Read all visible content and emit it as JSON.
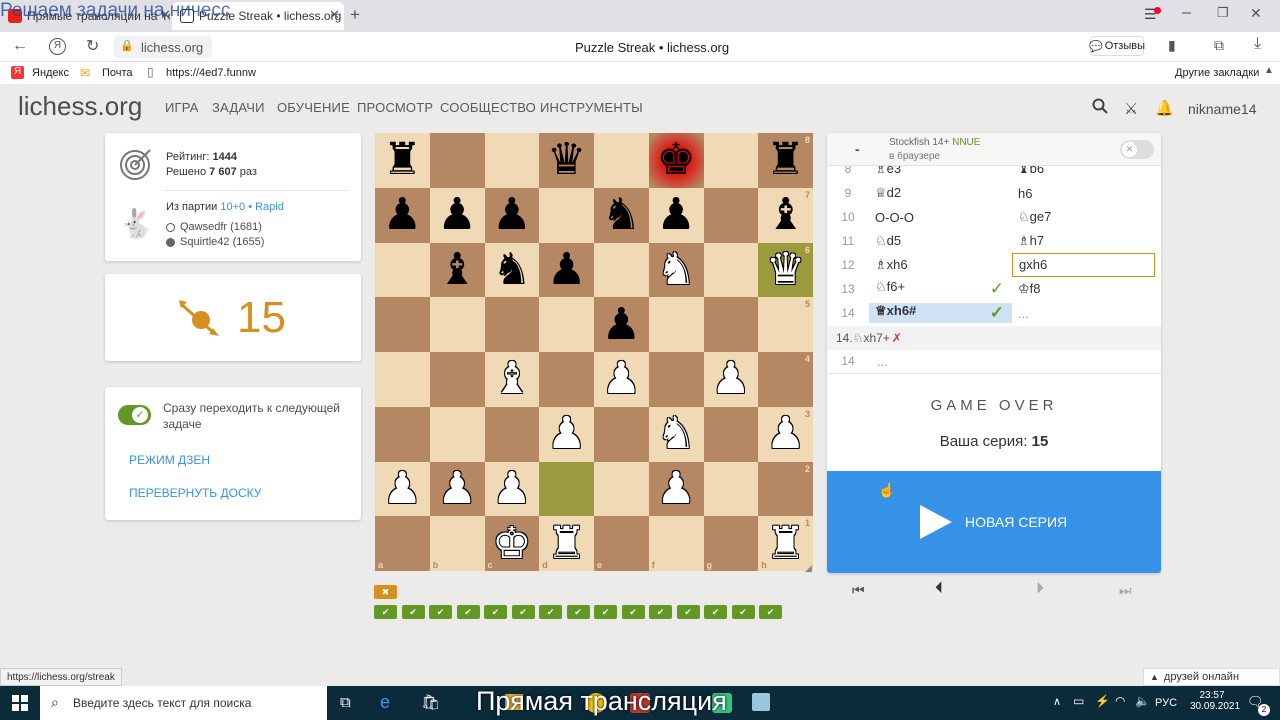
{
  "browser": {
    "tabs": [
      {
        "title": "Прямые трансляции на Youtube"
      },
      {
        "title": "Puzzle Streak • lichess.org"
      }
    ],
    "overlay_title": "Решаем задачи на ничесс",
    "url": "lichess.org",
    "page_title": "Puzzle Streak • lichess.org",
    "feedback": "Отзывы",
    "bookmarks": [
      "Яндекс",
      "Почта",
      "https://4ed7.funnw"
    ],
    "other_bookmarks": "Другие закладки"
  },
  "site": {
    "logo": "lichess",
    "logo_tld": ".org",
    "nav": [
      "ИГРА",
      "ЗАДАЧИ",
      "ОБУЧЕНИЕ",
      "ПРОСМОТР",
      "СООБЩЕСТВО",
      "ИНСТРУМЕНТЫ"
    ],
    "username": "nikname14"
  },
  "info": {
    "rating_label": "Рейтинг:",
    "rating": "1444",
    "solved_label": "Решено",
    "solved": "7 607",
    "solved_suffix": "раз",
    "from_game": "Из партии",
    "game_type": "10+0 • Rapid",
    "player_white": "Qawsedfr (1681)",
    "player_black": "Squirtle42 (1655)"
  },
  "streak": {
    "count": "15"
  },
  "options": {
    "auto_next": "Сразу переходить к следующей задаче",
    "zen": "РЕЖИМ ДЗЕН",
    "flip": "ПЕРЕВЕРНУТЬ ДОСКУ"
  },
  "engine": {
    "toggle": "-",
    "name": "Stockfish 14+",
    "nnue": "NNUE",
    "sub": "в браузере"
  },
  "moves": [
    {
      "n": "8",
      "w": "♗e3",
      "b": "♝b6",
      "wcheck": false
    },
    {
      "n": "9",
      "w": "♕d2",
      "b": "h6",
      "wcheck": false
    },
    {
      "n": "10",
      "w": "O-O-O",
      "b": "♘ge7",
      "wcheck": false
    },
    {
      "n": "11",
      "w": "♘d5",
      "b": "♗h7",
      "wcheck": false
    },
    {
      "n": "12",
      "w": "♗xh6",
      "b": "gxh6",
      "wcheck": false
    },
    {
      "n": "13",
      "w": "♘f6+",
      "b": "♔f8",
      "wcheck": true
    },
    {
      "n": "14",
      "w": "♕xh6#",
      "b": "...",
      "wcheck": true
    }
  ],
  "variation": {
    "text": "14.♘xh7+",
    "mark": "✗"
  },
  "extra_row": {
    "n": "14",
    "b": "..."
  },
  "game_over": {
    "title": "GAME OVER",
    "series_label": "Ваша серия:",
    "series": "15",
    "new_series": "НОВАЯ СЕРИЯ"
  },
  "results": {
    "failed": 1,
    "passed": 15
  },
  "status_url": "https://lichess.org/streak",
  "friends": "друзей онлайн",
  "taskbar": {
    "search": "Введите здесь текст для поиска",
    "overlay": "Прямая трансляция",
    "lang": "РУС",
    "time": "23:57",
    "date": "30.09.2021",
    "notif": "2"
  },
  "board": {
    "ranks": [
      "8",
      "7",
      "6",
      "5",
      "4",
      "3",
      "2",
      "1"
    ],
    "files": [
      "a",
      "b",
      "c",
      "d",
      "e",
      "f",
      "g",
      "h"
    ],
    "rows": [
      [
        "bR",
        "",
        "",
        "bQ",
        "",
        "bK",
        "",
        "bR"
      ],
      [
        "bP",
        "bP",
        "bP",
        "",
        "bN",
        "bP",
        "",
        "bB"
      ],
      [
        "",
        "bB",
        "bN",
        "bP",
        "",
        "wN",
        "",
        "wQ"
      ],
      [
        "",
        "",
        "",
        "",
        "bP",
        "",
        "",
        ""
      ],
      [
        "",
        "",
        "wB",
        "",
        "wP",
        "",
        "wP",
        ""
      ],
      [
        "",
        "",
        "",
        "wP",
        "",
        "wN",
        "",
        "wP"
      ],
      [
        "wP",
        "wP",
        "wP",
        "",
        "",
        "wP",
        "",
        ""
      ],
      [
        "",
        "",
        "wK",
        "wR",
        "",
        "",
        "",
        "wR"
      ]
    ],
    "check": "f8",
    "last_move": [
      "d2",
      "h6"
    ]
  },
  "colors": {
    "accent": "#3692e7",
    "success": "#629924",
    "gold": "#d59120",
    "check": "#e70000"
  }
}
